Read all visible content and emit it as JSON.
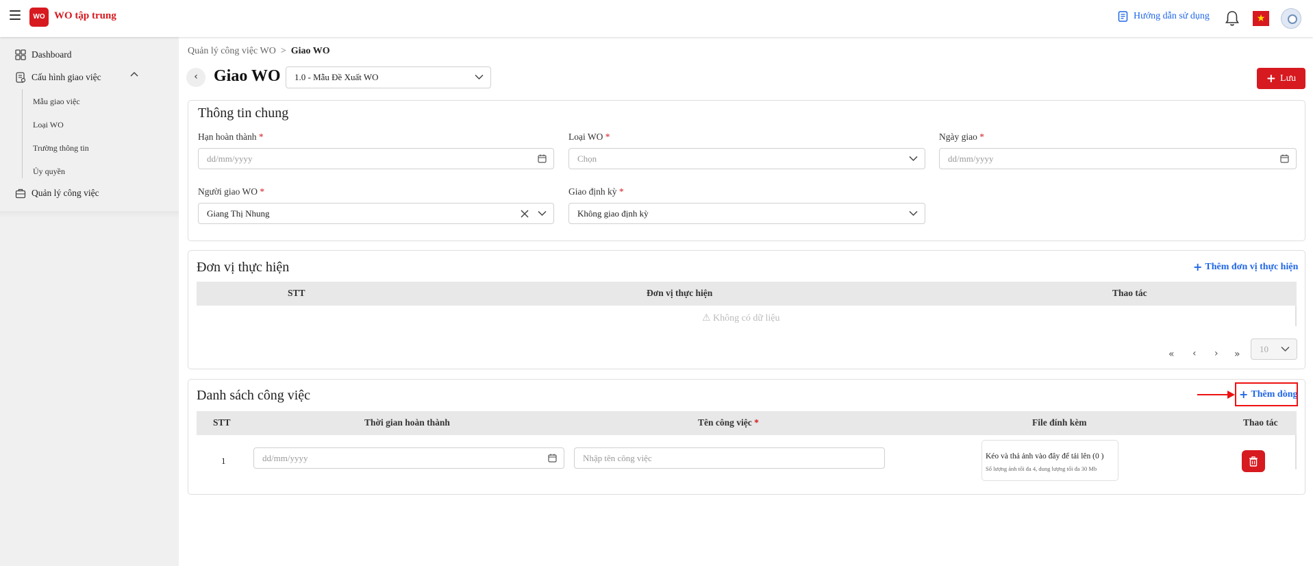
{
  "header": {
    "app_title": "WO tập trung",
    "logo_text": "WO",
    "guide_label": "Hướng dẫn sử dụng",
    "flag_star": "★"
  },
  "sidebar": {
    "items": [
      {
        "label": "Dashboard",
        "icon": "dashboard-icon"
      },
      {
        "label": "Cấu hình giao việc",
        "icon": "config-icon"
      },
      {
        "label": "Quản lý công việc",
        "icon": "briefcase-icon"
      }
    ],
    "sub_items": [
      {
        "label": "Mẫu giao việc"
      },
      {
        "label": "Loại WO"
      },
      {
        "label": "Trường thông tin"
      },
      {
        "label": "Ủy quyền"
      }
    ]
  },
  "breadcrumb": {
    "parent": "Quản lý công việc WO",
    "sep": ">",
    "current": "Giao WO"
  },
  "page": {
    "title": "Giao WO",
    "template_value": "1.0 - Mẫu Đề Xuất WO",
    "save_label": "Lưu"
  },
  "general": {
    "title": "Thông tin chung",
    "deadline": {
      "label": "Hạn hoàn thành",
      "placeholder": "dd/mm/yyyy"
    },
    "wo_type": {
      "label": "Loại WO",
      "placeholder": "Chọn"
    },
    "assign_date": {
      "label": "Ngày giao",
      "placeholder": "dd/mm/yyyy"
    },
    "assigner": {
      "label": "Người giao WO",
      "value": "Giang Thị Nhung"
    },
    "periodic": {
      "label": "Giao định kỳ",
      "value": "Không giao định kỳ"
    },
    "required_mark": "*"
  },
  "units": {
    "title": "Đơn vị thực hiện",
    "add_label": "Thêm đơn vị thực hiện",
    "columns": [
      "STT",
      "Đơn vị thực hiện",
      "Thao tác"
    ],
    "empty_text": "⚠ Không có dữ liệu",
    "pager": {
      "first": "«",
      "prev": "‹",
      "next": "›",
      "last": "»",
      "page_size": "10"
    }
  },
  "tasks": {
    "title": "Danh sách công việc",
    "add_label": "Thêm dòng",
    "columns": [
      "STT",
      "Thời gian hoàn thành",
      "Tên công việc",
      "File đính kèm",
      "Thao tác"
    ],
    "rows": [
      {
        "stt": "1",
        "time_placeholder": "dd/mm/yyyy",
        "name_placeholder": "Nhập tên công việc",
        "upload_text": "Kéo và thả ảnh vào đây để tải lên (0 )",
        "upload_hint": "Số lượng ảnh tối đa 4, dung lượng tối đa 30 Mb"
      }
    ]
  },
  "colors": {
    "brand": "#d71920",
    "link": "#1f66e6"
  }
}
